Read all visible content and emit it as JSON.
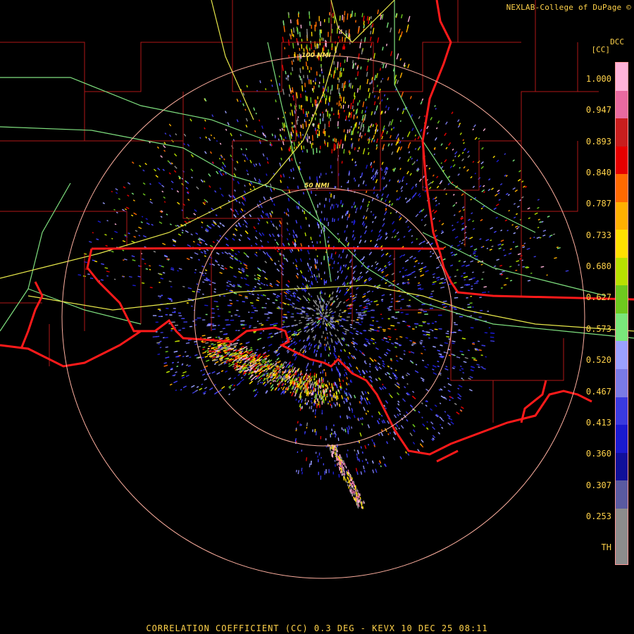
{
  "header": {
    "credit": "NEXLAB-College of DuPage ©",
    "product_code": "DCC",
    "units": "[CC]"
  },
  "footer": {
    "caption": "CORRELATION COEFFICIENT (CC) 0.3 DEG - KEVX 10 DEC 25 08:11"
  },
  "range_rings": [
    {
      "label": "50 NMI",
      "radius_nmi": 50
    },
    {
      "label": "100 NMI",
      "radius_nmi": 100
    }
  ],
  "legend": {
    "ticks": [
      "1.000",
      "0.947",
      "0.893",
      "0.840",
      "0.787",
      "0.733",
      "0.680",
      "0.627",
      "0.573",
      "0.520",
      "0.467",
      "0.413",
      "0.360",
      "0.307",
      "0.253",
      "TH"
    ],
    "colors": [
      "#ffb3d9",
      "#e86aa0",
      "#c81e1e",
      "#e60000",
      "#ff6a00",
      "#ffb000",
      "#ffe000",
      "#b8e000",
      "#6ec81e",
      "#7ae67a",
      "#9aa0ff",
      "#7a7ae6",
      "#3a3ae0",
      "#1a1ad0",
      "#10109a",
      "#5a5aa0",
      "#8c8c8c",
      "#8c8c8c"
    ],
    "accent": "#ffd24a"
  },
  "colors": {
    "state_border": "#ff1a1a",
    "county_border": "#b01818",
    "highway_major": "#e8e84a",
    "highway_minor": "#7fe07f",
    "range_ring": "#ffb0a0"
  }
}
